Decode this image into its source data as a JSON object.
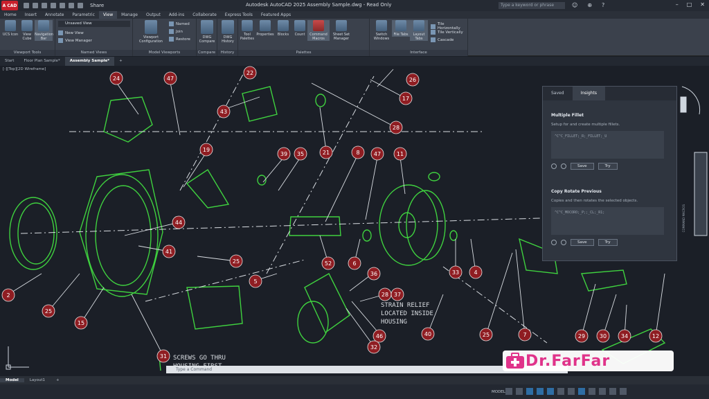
{
  "app": {
    "app_button": "A CAD",
    "share_label": "Share",
    "title": "Autodesk AutoCAD 2025   Assembly Sample.dwg - Read Only",
    "search_placeholder": "Type a keyword or phrase"
  },
  "ribbon_tabs": [
    "Home",
    "Insert",
    "Annotate",
    "Parametric",
    "View",
    "Manage",
    "Output",
    "Add-ins",
    "Collaborate",
    "Express Tools",
    "Featured Apps"
  ],
  "active_ribbon_tab": "View",
  "ribbon": {
    "viewport_tools": {
      "title": "Viewport Tools",
      "buttons": [
        "UCS Icon",
        "View Cube",
        "Navigation Bar"
      ]
    },
    "named_views": {
      "title": "Named Views",
      "combo": "Unsaved View",
      "items": [
        "New View",
        "View Manager"
      ]
    },
    "model_viewports": {
      "title": "Model Viewports",
      "button": "Viewport Configuration",
      "items": [
        "Named",
        "Join",
        "Restore"
      ]
    },
    "compare": {
      "title": "Compare",
      "button": "DWG Compare"
    },
    "history": {
      "title": "History",
      "button": "DWG History"
    },
    "palettes": {
      "title": "Palettes",
      "buttons": [
        "Tool Palettes",
        "Properties",
        "Blocks",
        "Count",
        "Command Macros",
        "Sheet Set Manager"
      ]
    },
    "interface": {
      "title": "Interface",
      "buttons": [
        "Switch Windows",
        "File Tabs",
        "Layout Tabs"
      ],
      "items": [
        "Tile Horizontally",
        "Tile Vertically",
        "Cascade"
      ]
    }
  },
  "doc_tabs": [
    "Start",
    "Floor Plan Sample*",
    "Assembly Sample*"
  ],
  "active_doc_tab": "Assembly Sample*",
  "viewport_label": "[-][Top][2D Wireframe]",
  "balloons": [
    "24",
    "47",
    "22",
    "26",
    "17",
    "43",
    "28",
    "19",
    "39",
    "35",
    "21",
    "8",
    "47",
    "11",
    "44",
    "41",
    "25",
    "52",
    "6",
    "33",
    "4",
    "5",
    "36",
    "28",
    "37",
    "46",
    "32",
    "40",
    "2",
    "25",
    "15",
    "31",
    "25",
    "7",
    "29",
    "30",
    "34",
    "12"
  ],
  "drawing_notes": {
    "strain": [
      "STRAIN RELIEF",
      "LOCATED INSIDE",
      "HOUSING"
    ],
    "screws": [
      "SCREWS GO THRU",
      "HOUSING FIRST"
    ]
  },
  "palette": {
    "tabs": [
      "Saved",
      "Insights"
    ],
    "active_tab": "Insights",
    "cards": [
      {
        "title": "Multiple Fillet",
        "description": "Setup for and create multiple fillets.",
        "code": "^C^C_FILLET;_R;_FILLET;_U",
        "save": "Save",
        "try": "Try"
      },
      {
        "title": "Copy Rotate Previous",
        "description": "Copies and then rotates the selected objects.",
        "code": "^C^C_MOCORO;_P;;_CL;_R1;",
        "save": "Save",
        "try": "Try"
      }
    ],
    "side_label": "COMMAND MACROS"
  },
  "command_placeholder": "Type a Command",
  "layout_tabs": [
    "Model",
    "Layout1"
  ],
  "active_layout_tab": "Model",
  "status": {
    "mode": "MODEL"
  },
  "watermark": "Dr.FarFar",
  "colors": {
    "accent": "#2e6da4",
    "lines": "#3fd23f",
    "balloon": "#8f1d22",
    "watermark": "#e0338a"
  }
}
